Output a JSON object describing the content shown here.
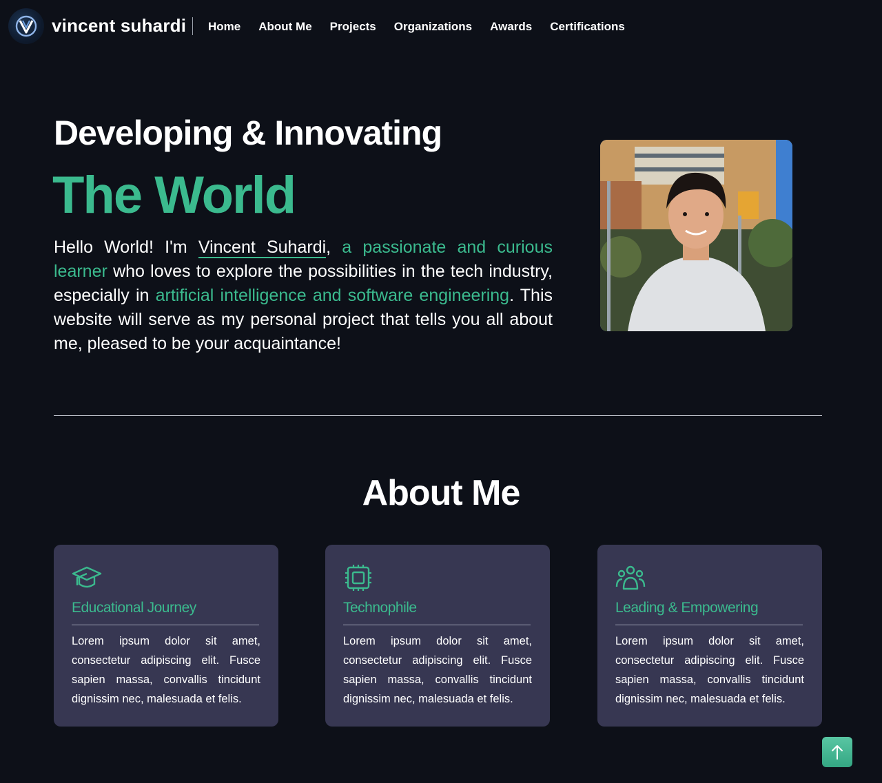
{
  "nav": {
    "brand": "vincent suhardi",
    "links": [
      "Home",
      "About Me",
      "Projects",
      "Organizations",
      "Awards",
      "Certifications"
    ]
  },
  "hero": {
    "heading_line1": "Developing & Innovating",
    "heading_line2": "The World",
    "intro_prefix": "Hello World! I'm ",
    "name": "Vincent Suhardi",
    "comma": ",",
    "highlight1": " a passionate and curious learner",
    "middle": " who loves to explore the possibilities in the tech industry, especially in ",
    "highlight2": "artificial intelligence and software engineering",
    "suffix": ". This website will serve as my personal project that tells you all about me, pleased to be your acquaintance!"
  },
  "about": {
    "title": "About Me",
    "cards": [
      {
        "icon": "graduation-cap-icon",
        "title": "Educational Journey",
        "body": "Lorem ipsum dolor sit amet, consectetur adipiscing elit. Fusce sapien massa, convallis tincidunt dignissim nec, malesuada et felis."
      },
      {
        "icon": "cpu-chip-icon",
        "title": "Technophile",
        "body": "Lorem ipsum dolor sit amet, consectetur adipiscing elit. Fusce sapien massa, convallis tincidunt dignissim nec, malesuada et felis."
      },
      {
        "icon": "people-group-icon",
        "title": "Leading & Empowering",
        "body": "Lorem ipsum dolor sit amet, consectetur adipiscing elit. Fusce sapien massa, convallis tincidunt dignissim nec, malesuada et felis."
      }
    ]
  },
  "colors": {
    "accent": "#3bba8e",
    "background": "#0d1018",
    "card": "#373752"
  }
}
